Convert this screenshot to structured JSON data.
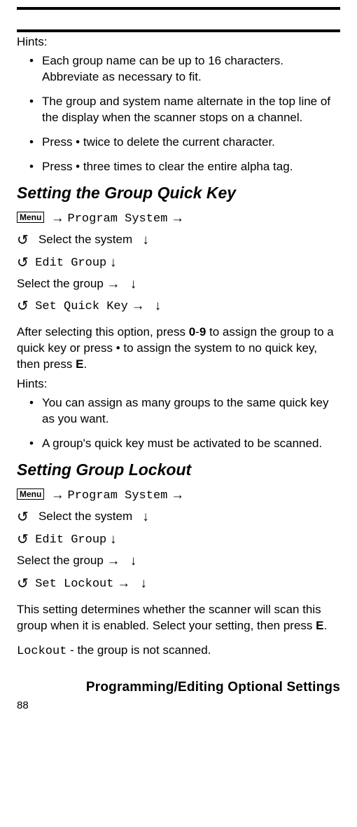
{
  "hintsLabel": "Hints:",
  "hintsA": [
    "Each group name can be up to 16 characters. Abbreviate as necessary to fit.",
    "The group and system name alternate in the top line of the display when the scanner stops on a channel.",
    "Press  •  twice to delete the current character.",
    "Press  •  three times to clear the entire alpha tag."
  ],
  "section1": "Setting the Group Quick Key",
  "menuKey": "Menu",
  "nav": {
    "programSystem": "Program System",
    "selectSystem": "Select the system",
    "editGroup": "Edit Group",
    "selectGroup": "Select the group",
    "setQuickKey": "Set Quick Key",
    "setLockout": "Set Lockout"
  },
  "glyph": {
    "arrowRight": "→",
    "arrowDown": "↓",
    "rotate": "↺"
  },
  "para1a": "After selecting this option, press ",
  "para1b": "0",
  "para1c": "-",
  "para1d": "9",
  "para1e": " to assign the group to a quick key or press  •  to assign the system to no quick key, then press ",
  "para1f": "E",
  "para1g": ".",
  "hintsLabel2": "Hints:",
  "hintsB": [
    "You can assign as many groups to the same quick key as you want.",
    "A group's quick key must be activated to be scanned."
  ],
  "section2": "Setting Group Lockout",
  "para2a": "This setting determines whether the scanner will scan this group when it is enabled. Select your setting, then press ",
  "para2b": "E",
  "para2c": ".",
  "lockoutCode": "Lockout",
  "lockoutRest": " - the group is not scanned.",
  "footerTitle": "Programming/Editing Optional Settings",
  "pageNum": "88"
}
